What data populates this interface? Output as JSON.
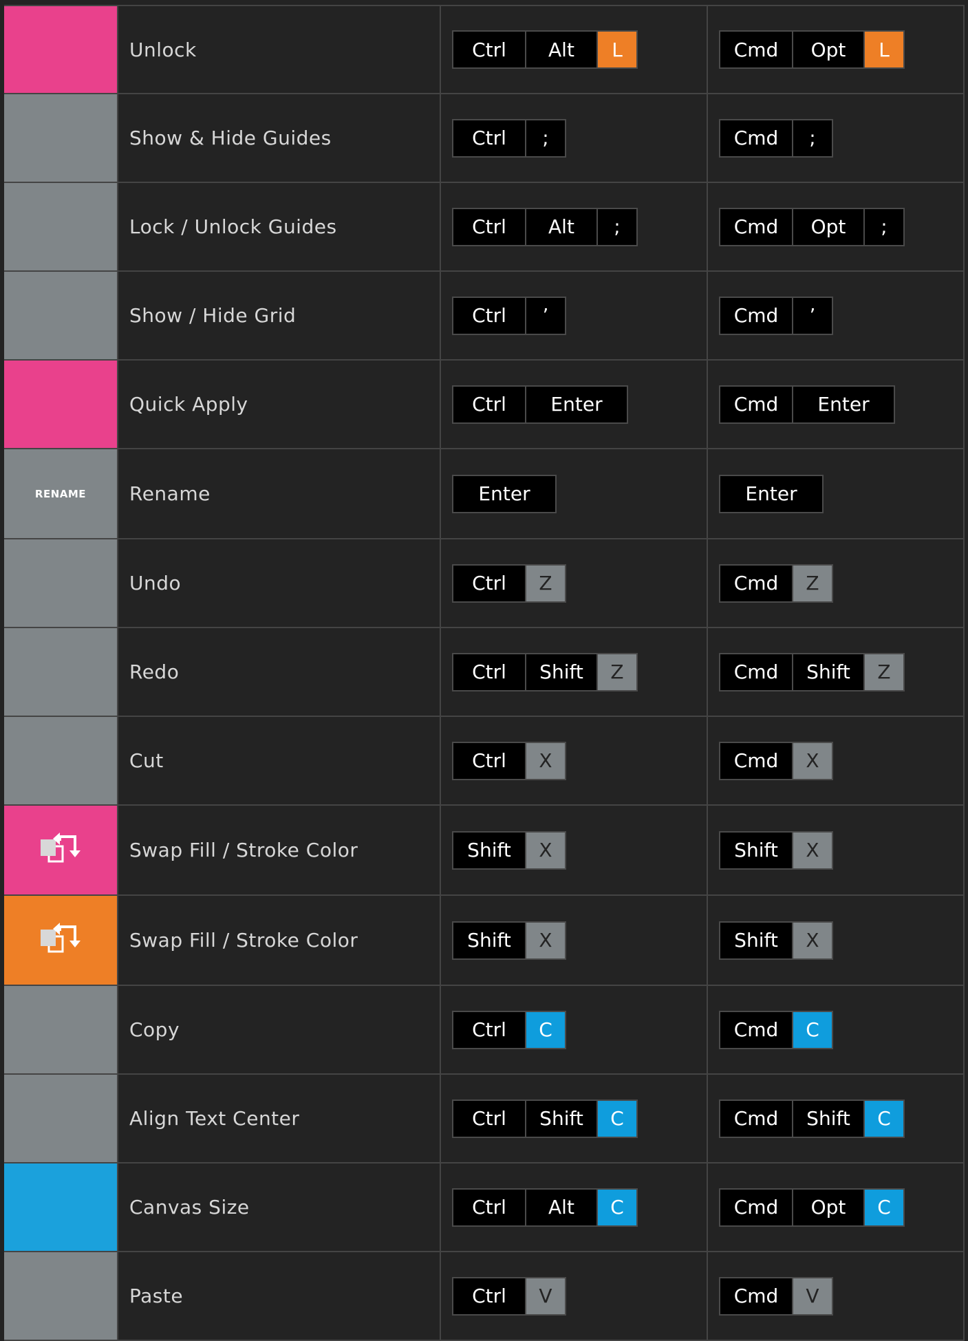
{
  "colors": {
    "pink": "#e9418c",
    "grey": "#808689",
    "orange": "#ee7f26",
    "blue": "#1ba1dc"
  },
  "rows": [
    {
      "icon_color": "pink",
      "name": "Unlock",
      "win": [
        "Ctrl",
        "Alt",
        "L"
      ],
      "mac": [
        "Cmd",
        "Opt",
        "L"
      ],
      "accent": "orange"
    },
    {
      "icon_color": "grey",
      "name": "Show & Hide Guides",
      "win": [
        "Ctrl",
        ";"
      ],
      "mac": [
        "Cmd",
        ";"
      ],
      "accent": "none"
    },
    {
      "icon_color": "grey",
      "name": "Lock / Unlock Guides",
      "win": [
        "Ctrl",
        "Alt",
        ";"
      ],
      "mac": [
        "Cmd",
        "Opt",
        ";"
      ],
      "accent": "none"
    },
    {
      "icon_color": "grey",
      "name": "Show / Hide Grid",
      "win": [
        "Ctrl",
        "’"
      ],
      "mac": [
        "Cmd",
        "’"
      ],
      "accent": "none"
    },
    {
      "icon_color": "pink",
      "name": "Quick Apply",
      "win": [
        "Ctrl",
        "Enter"
      ],
      "mac": [
        "Cmd",
        "Enter"
      ],
      "accent": "none"
    },
    {
      "icon_color": "grey",
      "icon_label": "RENAME",
      "name": "Rename",
      "win": [
        "Enter"
      ],
      "mac": [
        "Enter"
      ],
      "accent": "none"
    },
    {
      "icon_color": "grey",
      "name": "Undo",
      "win": [
        "Ctrl",
        "Z"
      ],
      "mac": [
        "Cmd",
        "Z"
      ],
      "accent": "grey"
    },
    {
      "icon_color": "grey",
      "name": "Redo",
      "win": [
        "Ctrl",
        "Shift",
        "Z"
      ],
      "mac": [
        "Cmd",
        "Shift",
        "Z"
      ],
      "accent": "grey"
    },
    {
      "icon_color": "grey",
      "name": "Cut",
      "win": [
        "Ctrl",
        "X"
      ],
      "mac": [
        "Cmd",
        "X"
      ],
      "accent": "grey"
    },
    {
      "icon_color": "pink",
      "icon": "swap-fill-stroke-icon",
      "name": "Swap Fill / Stroke Color",
      "win": [
        "Shift",
        "X"
      ],
      "mac": [
        "Shift",
        "X"
      ],
      "accent": "grey"
    },
    {
      "icon_color": "orange",
      "icon": "swap-fill-stroke-icon",
      "name": "Swap Fill / Stroke Color",
      "win": [
        "Shift",
        "X"
      ],
      "mac": [
        "Shift",
        "X"
      ],
      "accent": "grey"
    },
    {
      "icon_color": "grey",
      "name": "Copy",
      "win": [
        "Ctrl",
        "C"
      ],
      "mac": [
        "Cmd",
        "C"
      ],
      "accent": "blue"
    },
    {
      "icon_color": "grey",
      "name": "Align Text Center",
      "win": [
        "Ctrl",
        "Shift",
        "C"
      ],
      "mac": [
        "Cmd",
        "Shift",
        "C"
      ],
      "accent": "blue"
    },
    {
      "icon_color": "blue",
      "name": "Canvas Size",
      "win": [
        "Ctrl",
        "Alt",
        "C"
      ],
      "mac": [
        "Cmd",
        "Opt",
        "C"
      ],
      "accent": "blue"
    },
    {
      "icon_color": "grey",
      "name": "Paste",
      "win": [
        "Ctrl",
        "V"
      ],
      "mac": [
        "Cmd",
        "V"
      ],
      "accent": "grey"
    }
  ]
}
